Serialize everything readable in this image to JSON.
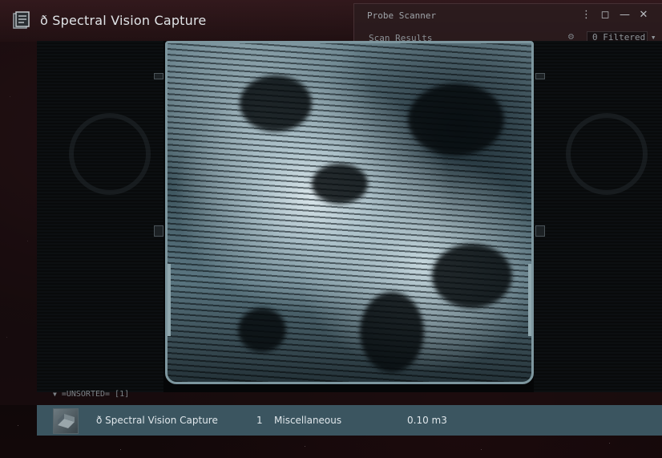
{
  "window": {
    "title": "ð Spectral Vision Capture",
    "icon": "info-document-icon"
  },
  "probe_scanner": {
    "title": "Probe Scanner",
    "controls": {
      "menu": "⋮",
      "restore": "◻",
      "minimize": "—",
      "close": "✕"
    },
    "scan_results_label": "Scan Results",
    "filter_value": "0 Filtered ▾"
  },
  "image": {
    "description_icon": "corrupted-portrait-image"
  },
  "list": {
    "group_label": "=UNSORTED= [1]",
    "items": [
      {
        "name": "ð Spectral Vision Capture",
        "quantity": "1",
        "group": "Miscellaneous",
        "volume": "0.10 m3"
      }
    ]
  },
  "colors": {
    "row_highlight": "#3b5560",
    "background": "#0a0607",
    "text": "#dfe6ea"
  }
}
